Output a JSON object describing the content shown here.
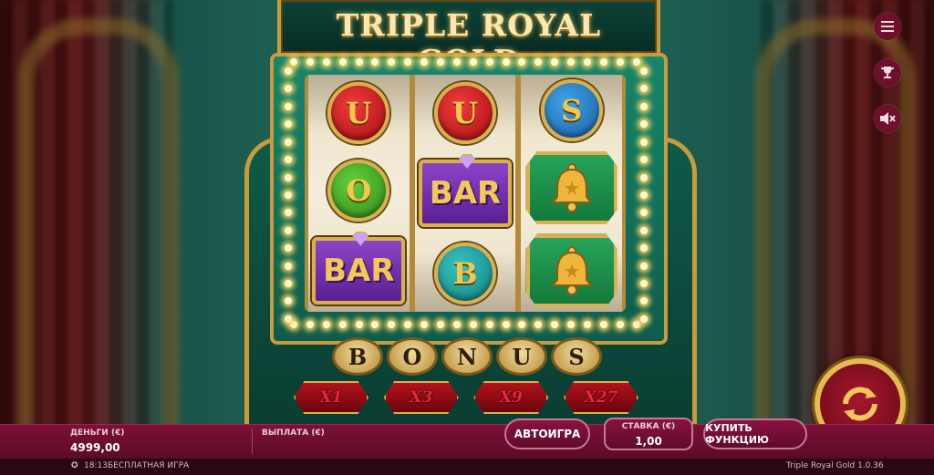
{
  "game": {
    "title": "TRIPLE ROYAL GOLD"
  },
  "reels": [
    [
      {
        "type": "letter",
        "value": "U",
        "color": "red"
      },
      {
        "type": "letter",
        "value": "O",
        "color": "green"
      },
      {
        "type": "bar",
        "value": "BAR"
      }
    ],
    [
      {
        "type": "letter",
        "value": "U",
        "color": "red"
      },
      {
        "type": "bar",
        "value": "BAR"
      },
      {
        "type": "letter",
        "value": "B",
        "color": "teal"
      }
    ],
    [
      {
        "type": "letter",
        "value": "S",
        "color": "blue"
      },
      {
        "type": "bell",
        "value": "bell"
      },
      {
        "type": "bell",
        "value": "bell"
      }
    ]
  ],
  "bonus": [
    "B",
    "O",
    "N",
    "U",
    "S"
  ],
  "multipliers": [
    "X1",
    "X3",
    "X9",
    "X27"
  ],
  "side_menu": {
    "menu_icon": "hamburger-menu-icon",
    "trophy_icon": "trophy-icon",
    "sound_icon": "sound-muted-icon"
  },
  "bottom_bar": {
    "balance_label": "ДЕНЬГИ (€)",
    "balance_value": "4999,00",
    "payout_label": "ВЫПЛАТА (€)",
    "autoplay_label": "АВТОИГРА",
    "bet_label": "СТАВКА (€)",
    "bet_value": "1,00",
    "buy_feature_label": "КУПИТЬ ФУНКЦИЮ"
  },
  "footer": {
    "clock": "18:13",
    "mode": "БЕСПЛАТНАЯ ИГРА",
    "version": "Triple Royal Gold 1.0.36"
  },
  "colors": {
    "accent_gold": "#c99b3c",
    "bar_bg": "#7d1037",
    "symbol_red": "#a80e14",
    "symbol_green": "#2f8a18",
    "symbol_blue": "#1a5fa8",
    "symbol_teal": "#127f80",
    "symbol_purple": "#5a1f92"
  }
}
